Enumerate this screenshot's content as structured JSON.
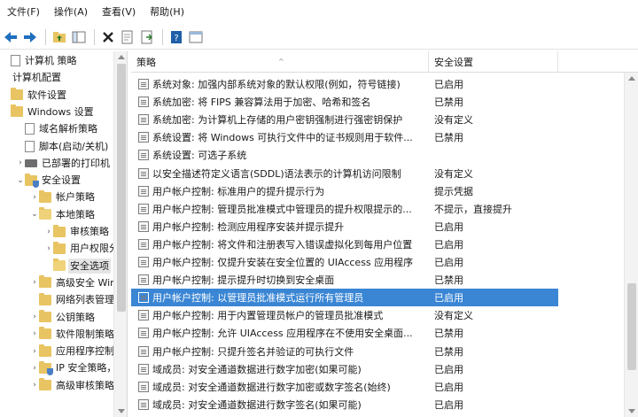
{
  "menu": [
    "文件(F)",
    "操作(A)",
    "查看(V)",
    "帮助(H)"
  ],
  "toolbar": {
    "icons": [
      "back-icon",
      "forward-icon",
      "up-folder-icon",
      "show-tree-icon",
      "delete-icon",
      "properties-icon",
      "export-icon",
      "help-icon",
      "view-icon"
    ],
    "colors": {
      "back": "#1f6fbf",
      "forward": "#1f6fbf",
      "delete": "#222222",
      "help": "#1f5fa8"
    }
  },
  "tree": [
    {
      "label": "计算机 策略",
      "level": 0,
      "icon": "doc",
      "twisty": ""
    },
    {
      "label": "计算机配置",
      "level": 0,
      "icon": "none",
      "twisty": ""
    },
    {
      "label": "软件设置",
      "level": 0,
      "icon": "folder",
      "twisty": ""
    },
    {
      "label": "Windows 设置",
      "level": 0,
      "icon": "folder",
      "twisty": ""
    },
    {
      "label": "域名解析策略",
      "level": 1,
      "icon": "doc",
      "twisty": ""
    },
    {
      "label": "脚本(启动/关机)",
      "level": 1,
      "icon": "doc",
      "twisty": ""
    },
    {
      "label": "已部署的打印机",
      "level": 1,
      "icon": "printer",
      "twisty": "›"
    },
    {
      "label": "安全设置",
      "level": 1,
      "icon": "shield",
      "twisty": "⌄"
    },
    {
      "label": "帐户策略",
      "level": 2,
      "icon": "folder",
      "twisty": "›"
    },
    {
      "label": "本地策略",
      "level": 2,
      "icon": "folder-open",
      "twisty": "⌄"
    },
    {
      "label": "审核策略",
      "level": 3,
      "icon": "folder",
      "twisty": "›"
    },
    {
      "label": "用户权限分",
      "level": 3,
      "icon": "folder",
      "twisty": "›"
    },
    {
      "label": "安全选项",
      "level": 3,
      "icon": "folder-open",
      "twisty": "",
      "selected": true
    },
    {
      "label": "高级安全 Winc",
      "level": 2,
      "icon": "folder",
      "twisty": "›"
    },
    {
      "label": "网络列表管理",
      "level": 2,
      "icon": "folder",
      "twisty": ""
    },
    {
      "label": "公钥策略",
      "level": 2,
      "icon": "folder",
      "twisty": "›"
    },
    {
      "label": "软件限制策略",
      "level": 2,
      "icon": "folder",
      "twisty": "›"
    },
    {
      "label": "应用程序控制",
      "level": 2,
      "icon": "folder",
      "twisty": "›"
    },
    {
      "label": "IP 安全策略，i",
      "level": 2,
      "icon": "shield",
      "twisty": "›"
    },
    {
      "label": "高级审核策略",
      "level": 2,
      "icon": "folder",
      "twisty": "›"
    }
  ],
  "list": {
    "columns": {
      "policy": "策略",
      "setting": "安全设置"
    },
    "rows": [
      {
        "policy": "系统对象: 加强内部系统对象的默认权限(例如，符号链接)",
        "setting": "已启用"
      },
      {
        "policy": "系统加密: 将 FIPS 兼容算法用于加密、哈希和签名",
        "setting": "已禁用"
      },
      {
        "policy": "系统加密: 为计算机上存储的用户密钥强制进行强密钥保护",
        "setting": "没有定义"
      },
      {
        "policy": "系统设置: 将 Windows 可执行文件中的证书规则用于软件...",
        "setting": "已禁用"
      },
      {
        "policy": "系统设置: 可选子系统",
        "setting": ""
      },
      {
        "policy": "以安全描述符定义语言(SDDL)语法表示的计算机访问限制",
        "setting": "没有定义"
      },
      {
        "policy": "用户帐户控制: 标准用户的提升提示行为",
        "setting": "提示凭据"
      },
      {
        "policy": "用户帐户控制: 管理员批准模式中管理员的提升权限提示的...",
        "setting": "不提示，直接提升"
      },
      {
        "policy": "用户帐户控制: 检测应用程序安装并提示提升",
        "setting": "已启用"
      },
      {
        "policy": "用户帐户控制: 将文件和注册表写入错误虚拟化到每用户位置",
        "setting": "已启用"
      },
      {
        "policy": "用户帐户控制: 仅提升安装在安全位置的 UIAccess 应用程序",
        "setting": "已启用"
      },
      {
        "policy": "用户帐户控制: 提示提升时切换到安全桌面",
        "setting": "已禁用"
      },
      {
        "policy": "用户帐户控制: 以管理员批准模式运行所有管理员",
        "setting": "已启用",
        "selected": true
      },
      {
        "policy": "用户帐户控制: 用于内置管理员帐户的管理员批准模式",
        "setting": "没有定义"
      },
      {
        "policy": "用户帐户控制: 允许 UIAccess 应用程序在不使用安全桌面...",
        "setting": "已禁用"
      },
      {
        "policy": "用户帐户控制: 只提升签名并验证的可执行文件",
        "setting": "已禁用"
      },
      {
        "policy": "域成员: 对安全通道数据进行数字加密(如果可能)",
        "setting": "已启用"
      },
      {
        "policy": "域成员: 对安全通道数据进行数字加密或数字签名(始终)",
        "setting": "已启用"
      },
      {
        "policy": "域成员: 对安全通道数据进行数字签名(如果可能)",
        "setting": "已启用"
      }
    ]
  },
  "colors": {
    "selection": "#3a86d4",
    "folder": "#e8c462"
  }
}
